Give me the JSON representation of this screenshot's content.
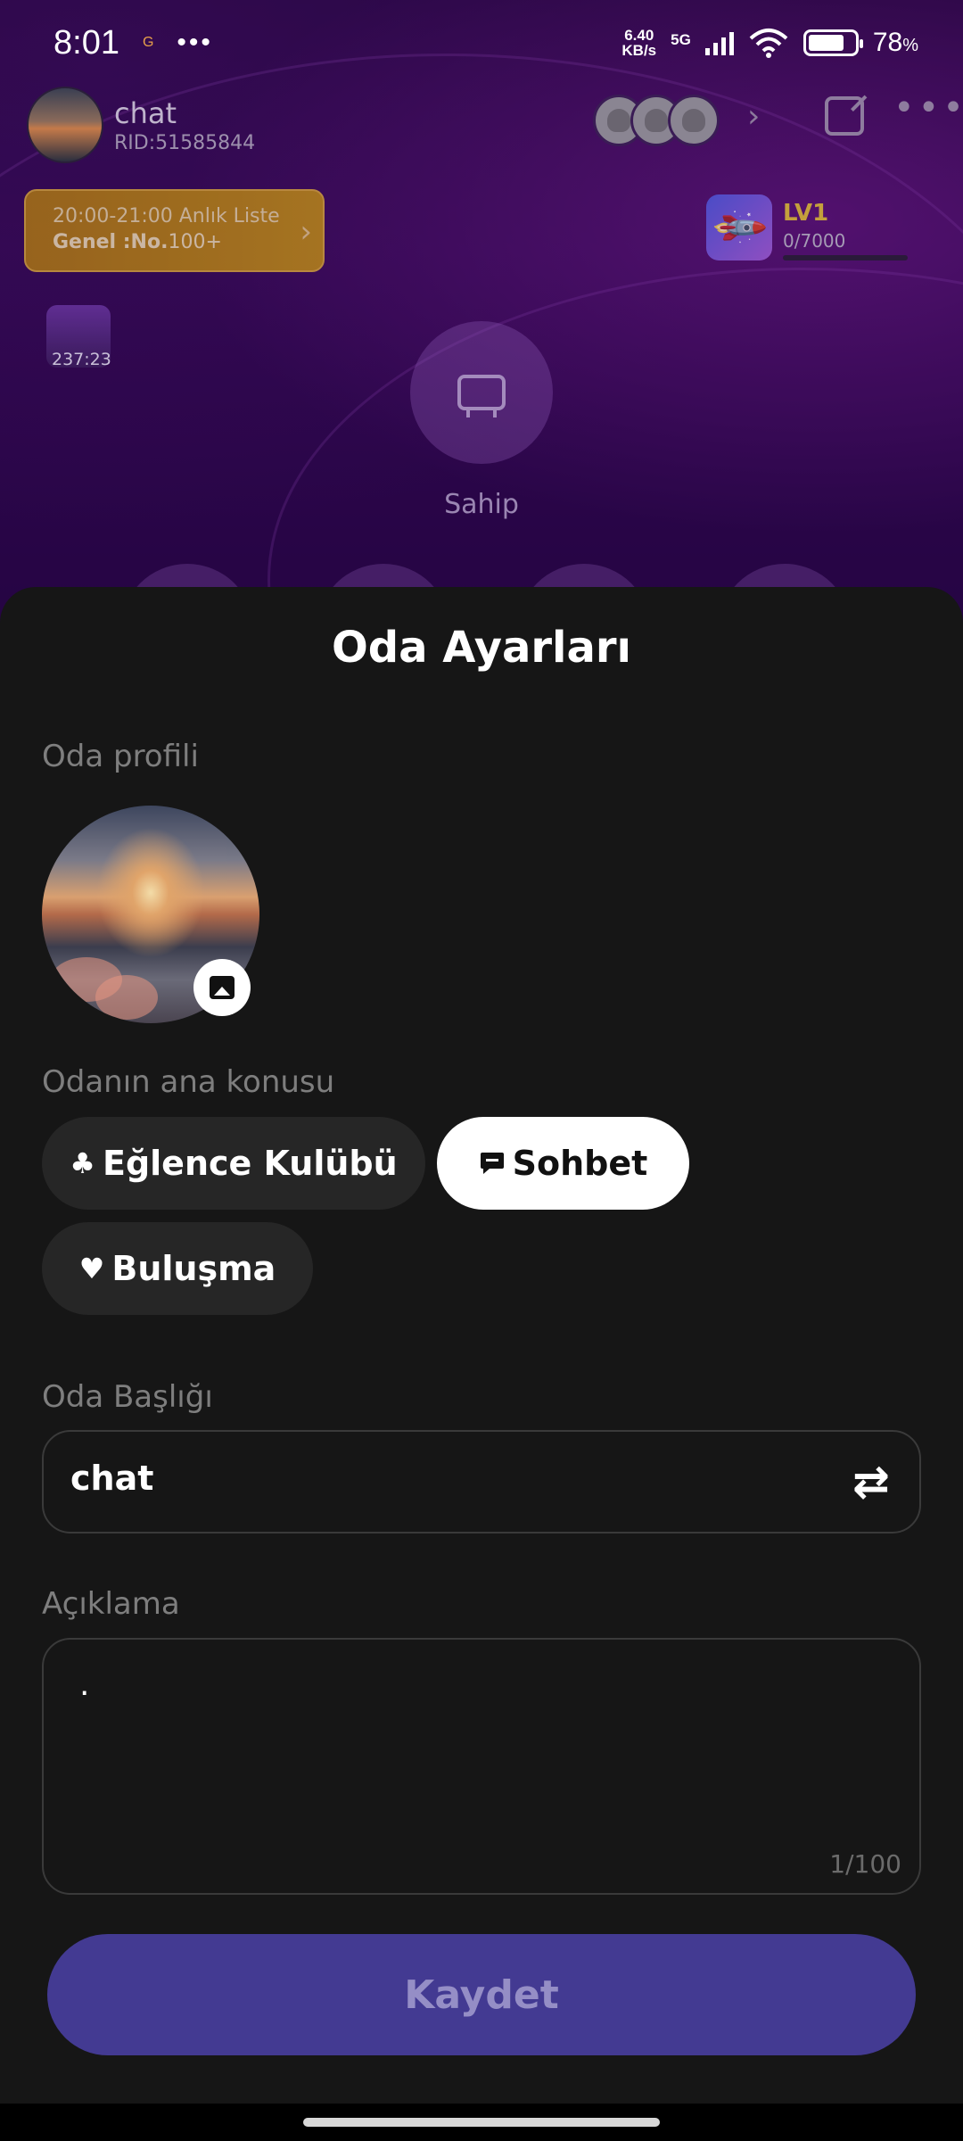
{
  "status_bar": {
    "time": "8:01",
    "g_icon": "G",
    "net_speed_value": "6.40",
    "net_speed_unit": "KB/s",
    "network": "5G",
    "battery": "78",
    "battery_unit": "%",
    "battery_level": 0.78
  },
  "room": {
    "name": "chat",
    "rid": "RID:51585844",
    "rank": {
      "line1": "20:00-21:00 Anlık Liste",
      "line2_bold": "Genel :No.",
      "line2_value": "100+"
    },
    "level": {
      "label": "LV1",
      "progress": "0/7000",
      "fraction": 0
    },
    "game_timer": "237:23",
    "seat_label": "Sahip"
  },
  "sheet": {
    "title": "Oda Ayarları",
    "profile_label": "Oda profili",
    "topic_label": "Odanın ana konusu",
    "topics": [
      {
        "label": "Eğlence Kulübü",
        "icon": "club-icon",
        "glyph": "♣",
        "selected": false
      },
      {
        "label": "Sohbet",
        "icon": "chat-bubble-icon",
        "glyph": "▬",
        "selected": true
      },
      {
        "label": "Buluşma",
        "icon": "heart-icon",
        "glyph": "♥",
        "selected": false
      }
    ],
    "title_label": "Oda Başlığı",
    "title_value": "chat",
    "description_label": "Açıklama",
    "description_value": ".",
    "description_counter": "1/100",
    "save_label": "Kaydet"
  },
  "colors": {
    "sheet_bg": "#161616",
    "chip_bg": "#262626",
    "chip_selected_bg": "#ffffff",
    "save_button_bg": "#433a92",
    "save_button_text": "#958ec6",
    "label_gray": "#7e7e7e"
  }
}
